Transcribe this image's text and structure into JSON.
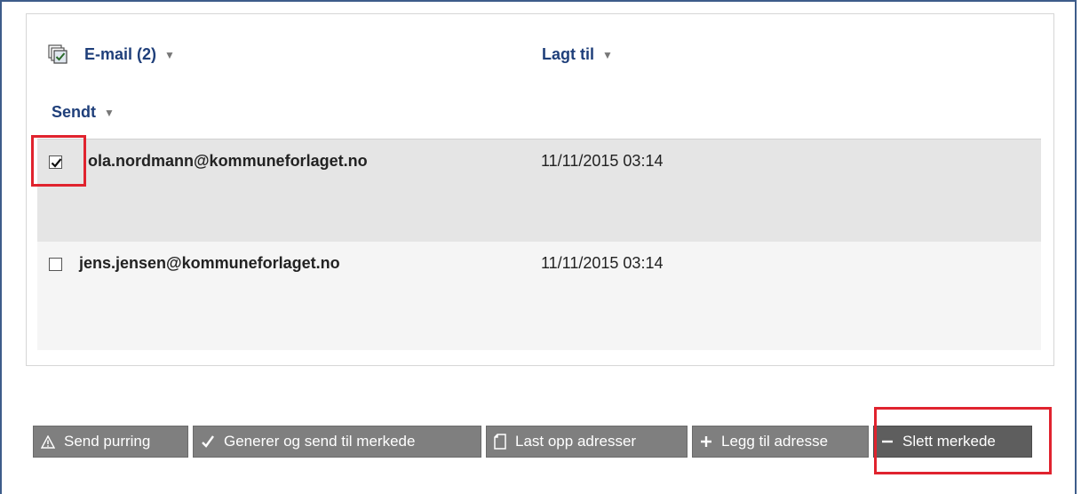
{
  "header": {
    "email_label": "E-mail (2)",
    "added_label": "Lagt til",
    "sent_label": "Sendt",
    "caret": "▼"
  },
  "rows": [
    {
      "email": "ola.nordmann@kommuneforlaget.no",
      "added": "11/11/2015 03:14",
      "checked": true
    },
    {
      "email": "jens.jensen@kommuneforlaget.no",
      "added": "11/11/2015 03:14",
      "checked": false
    }
  ],
  "buttons": {
    "send_reminder": "Send purring",
    "generate_send": "Generer og send til merkede",
    "upload_addresses": "Last opp adresser",
    "add_address": "Legg til adresse",
    "delete_marked": "Slett merkede"
  },
  "icons": {
    "send_reminder": "warning-icon",
    "generate_send": "checkmark-icon",
    "upload_addresses": "document-icon",
    "add_address": "plus-icon",
    "delete_marked": "minus-icon",
    "select_all": "select-all-icon"
  },
  "colors": {
    "header_text": "#1f3f7a",
    "highlight": "#e0232e",
    "button_bg": "#7f7f7f"
  }
}
